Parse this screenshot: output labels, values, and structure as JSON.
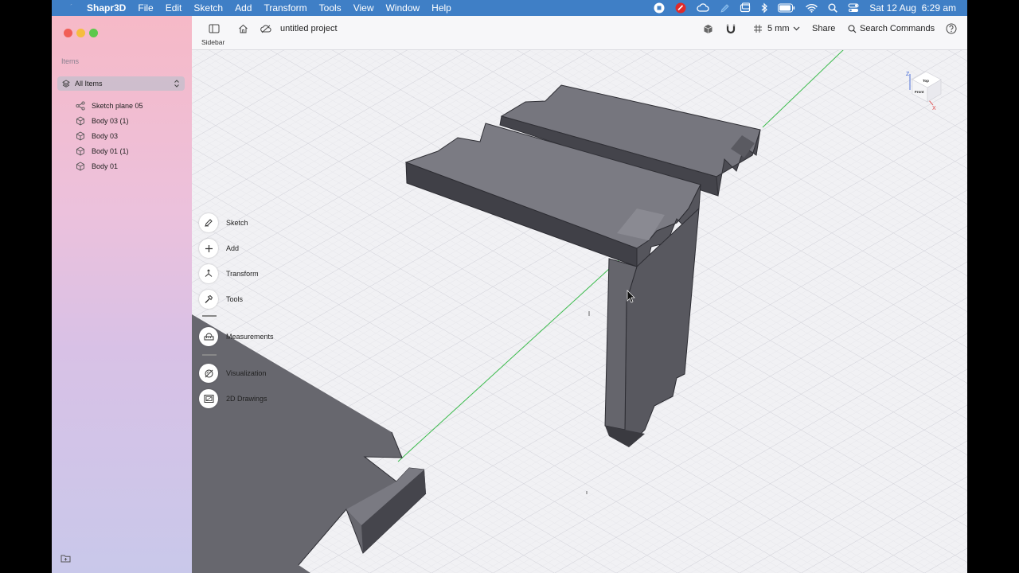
{
  "menubar": {
    "app_name": "Shapr3D",
    "menus": [
      "File",
      "Edit",
      "Sketch",
      "Add",
      "Transform",
      "Tools",
      "View",
      "Window",
      "Help"
    ],
    "clock": "Sat 12 Aug  6:29 am",
    "status_icons": [
      "record-icon",
      "red-app-icon",
      "cloud-icon",
      "pen-icon",
      "window-icon",
      "bluetooth-icon",
      "battery-icon",
      "wifi-icon",
      "search-icon",
      "control-center-icon"
    ]
  },
  "sidebar": {
    "section_label": "Items",
    "filter_label": "All Items",
    "items": [
      {
        "label": "Sketch plane 05",
        "icon": "sketch-plane-icon"
      },
      {
        "label": "Body 03 (1)",
        "icon": "body-icon"
      },
      {
        "label": "Body 03",
        "icon": "body-icon"
      },
      {
        "label": "Body 01 (1)",
        "icon": "body-icon"
      },
      {
        "label": "Body 01",
        "icon": "body-icon"
      }
    ]
  },
  "toolbar": {
    "sidebar_caption": "Sidebar",
    "project_name": "untitled project",
    "grid_size": "5 mm",
    "share_label": "Share",
    "search_label": "Search Commands"
  },
  "tools": [
    {
      "label": "Sketch",
      "icon": "pen-icon"
    },
    {
      "label": "Add",
      "icon": "plus-icon"
    },
    {
      "label": "Transform",
      "icon": "transform-icon"
    },
    {
      "label": "Tools",
      "icon": "hammer-icon"
    },
    {
      "label": "Measurements",
      "icon": "ruler-icon"
    },
    {
      "label": "Visualization",
      "icon": "visualization-icon"
    },
    {
      "label": "2D Drawings",
      "icon": "drawing-icon"
    }
  ],
  "colors": {
    "menubar": "#3f7fc6",
    "canvas": "#f1f1f4",
    "model_top": "#75757d",
    "model_side": "#4d4d55",
    "model_dark": "#35353b",
    "axis_green": "#3cbb4d"
  }
}
